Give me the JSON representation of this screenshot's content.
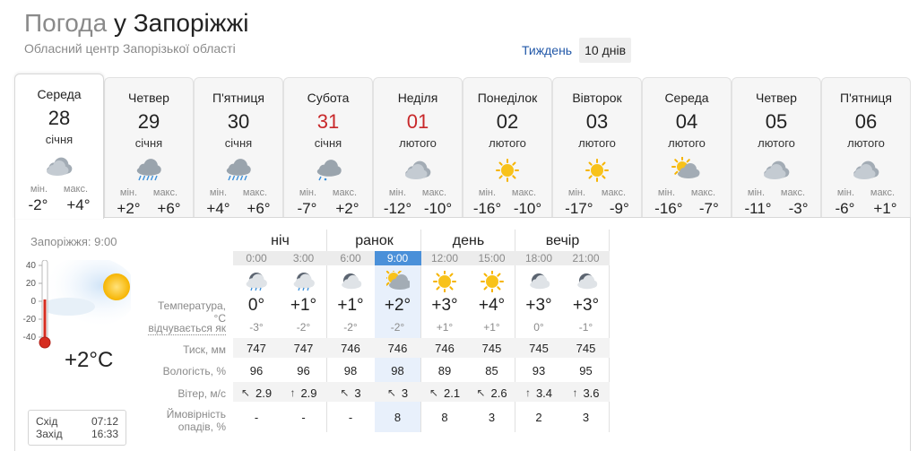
{
  "header": {
    "title_prefix": "Погода",
    "title_city": "у Запоріжжі",
    "subtitle": "Обласний центр Запорізької області"
  },
  "view_switch": {
    "week": "Тиждень",
    "ten_days": "10 днів"
  },
  "min_label": "мін.",
  "max_label": "макс.",
  "days": [
    {
      "name": "Середа",
      "num": "28",
      "month": "січня",
      "min": "-2°",
      "max": "+4°",
      "icon": "cloud-icon",
      "active": true,
      "red": false
    },
    {
      "name": "Четвер",
      "num": "29",
      "month": "січня",
      "min": "+2°",
      "max": "+6°",
      "icon": "cloud-rain-icon",
      "active": false,
      "red": false
    },
    {
      "name": "П'ятниця",
      "num": "30",
      "month": "січня",
      "min": "+4°",
      "max": "+6°",
      "icon": "cloud-rain-icon",
      "active": false,
      "red": false
    },
    {
      "name": "Субота",
      "num": "31",
      "month": "січня",
      "min": "-7°",
      "max": "+2°",
      "icon": "cloud-sleet-icon",
      "active": false,
      "red": true
    },
    {
      "name": "Неділя",
      "num": "01",
      "month": "лютого",
      "min": "-12°",
      "max": "-10°",
      "icon": "cloud-icon",
      "active": false,
      "red": true
    },
    {
      "name": "Понеділок",
      "num": "02",
      "month": "лютого",
      "min": "-16°",
      "max": "-10°",
      "icon": "sun-icon",
      "active": false,
      "red": false
    },
    {
      "name": "Вівторок",
      "num": "03",
      "month": "лютого",
      "min": "-17°",
      "max": "-9°",
      "icon": "sun-icon",
      "active": false,
      "red": false
    },
    {
      "name": "Середа",
      "num": "04",
      "month": "лютого",
      "min": "-16°",
      "max": "-7°",
      "icon": "sun-cloud-icon",
      "active": false,
      "red": false
    },
    {
      "name": "Четвер",
      "num": "05",
      "month": "лютого",
      "min": "-11°",
      "max": "-3°",
      "icon": "cloud-icon",
      "active": false,
      "red": false
    },
    {
      "name": "П'ятниця",
      "num": "06",
      "month": "лютого",
      "min": "-6°",
      "max": "+1°",
      "icon": "cloud-icon",
      "active": false,
      "red": false
    }
  ],
  "now": {
    "place_time": "Запоріжжя: 9:00",
    "temp": "+2°C",
    "scale": [
      "40",
      "20",
      "0",
      "-20",
      "-40"
    ],
    "sunrise_label": "Схід",
    "sunrise": "07:12",
    "sunset_label": "Захід",
    "sunset": "16:33"
  },
  "periods": [
    "ніч",
    "ранок",
    "день",
    "вечір"
  ],
  "hours": [
    "0:00",
    "3:00",
    "6:00",
    "9:00",
    "12:00",
    "15:00",
    "18:00",
    "21:00"
  ],
  "active_hour_index": 3,
  "hour_icons": [
    "moon-cloud-rain-icon",
    "moon-cloud-rain-icon",
    "moon-cloud-icon",
    "sun-cloud-icon",
    "sun-icon",
    "sun-icon",
    "moon-cloud-icon",
    "moon-cloud-icon"
  ],
  "labels": {
    "temperature": "Температура, °C",
    "feels": "відчувається як",
    "pressure": "Тиск, мм",
    "humidity": "Вологість, %",
    "wind": "Вітер, м/с",
    "precip": "Ймовірність опадів, %"
  },
  "temperature": [
    "0°",
    "+1°",
    "+1°",
    "+2°",
    "+3°",
    "+4°",
    "+3°",
    "+3°"
  ],
  "feels": [
    "-3°",
    "-2°",
    "-2°",
    "-2°",
    "+1°",
    "+1°",
    "0°",
    "-1°"
  ],
  "pressure": [
    "747",
    "747",
    "746",
    "746",
    "746",
    "745",
    "745",
    "745"
  ],
  "humidity": [
    "96",
    "96",
    "98",
    "98",
    "89",
    "85",
    "93",
    "95"
  ],
  "wind_speed": [
    "2.9",
    "2.9",
    "3",
    "3",
    "2.1",
    "2.6",
    "3.4",
    "3.6"
  ],
  "wind_arrow": [
    "↖",
    "↑",
    "↖",
    "↖",
    "↖",
    "↖",
    "↑",
    "↑"
  ],
  "precip": [
    "-",
    "-",
    "-",
    "8",
    "8",
    "3",
    "2",
    "3"
  ],
  "colors": {
    "link": "#2258a8",
    "active_hour": "#4a90d9",
    "weekend": "#c8282a",
    "sun": "#f6b400",
    "cloud": "#9aa4ad"
  }
}
